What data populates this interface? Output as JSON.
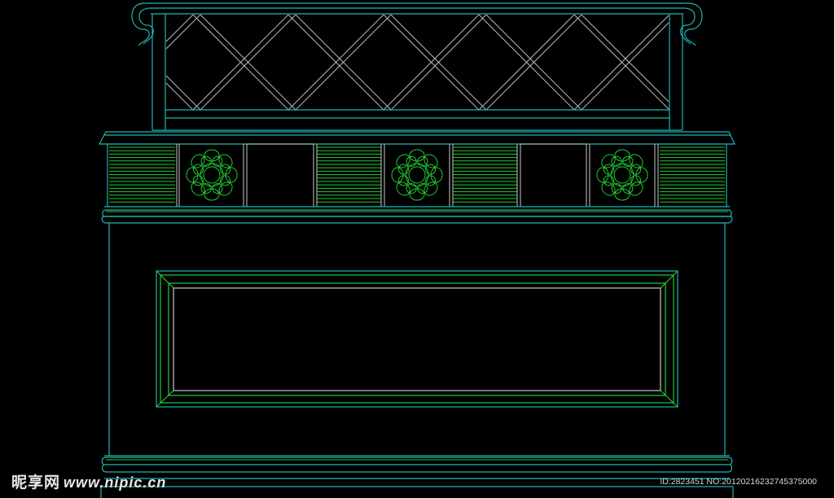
{
  "watermark": {
    "brand": "昵享网",
    "url": "www.nipic.cn",
    "id_text": "ID:2823451 NO:20120216232745375000"
  },
  "colors": {
    "background": "#000000",
    "cyan": "#1fb5b5",
    "green": "#22cc33",
    "white": "#c8c8c8"
  },
  "drawing": {
    "subject": "carved cabinet elevation",
    "carving_count": 3,
    "lattice_pattern": "diagonal-crosshatch"
  }
}
